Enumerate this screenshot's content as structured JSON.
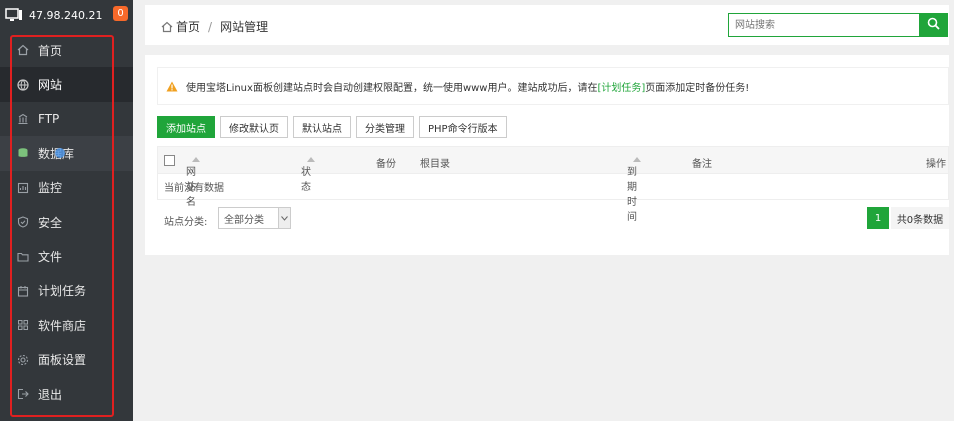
{
  "server": {
    "ip": "47.98.240.21",
    "badge": "0"
  },
  "nav": [
    {
      "label": "首页",
      "icon": "home-icon"
    },
    {
      "label": "网站",
      "icon": "globe-icon"
    },
    {
      "label": "FTP",
      "icon": "ftp-icon"
    },
    {
      "label": "数据库",
      "icon": "database-icon"
    },
    {
      "label": "监控",
      "icon": "monitor-icon"
    },
    {
      "label": "安全",
      "icon": "shield-icon"
    },
    {
      "label": "文件",
      "icon": "folder-icon"
    },
    {
      "label": "计划任务",
      "icon": "calendar-icon"
    },
    {
      "label": "软件商店",
      "icon": "grid-icon"
    },
    {
      "label": "面板设置",
      "icon": "gear-icon"
    },
    {
      "label": "退出",
      "icon": "logout-icon"
    }
  ],
  "breadcrumb": {
    "home": "首页",
    "sep": "/",
    "current": "网站管理"
  },
  "search": {
    "placeholder": "网站搜索"
  },
  "alert": {
    "prefix": "使用宝塔Linux面板创建站点时会自动创建权限配置，统一使用www用户。建站成功后，请在",
    "link": "[计划任务]",
    "suffix": "页面添加定时备份任务!"
  },
  "toolbar": {
    "add_site": "添加站点",
    "edit_default": "修改默认页",
    "default_site": "默认站点",
    "category": "分类管理",
    "php_cli": "PHP命令行版本"
  },
  "table": {
    "headers": {
      "name": "网站名",
      "status": "状态",
      "backup": "备份",
      "root": "根目录",
      "expire": "到期时间",
      "note": "备注",
      "action": "操作"
    },
    "empty": "当前没有数据"
  },
  "footer": {
    "category_label": "站点分类:",
    "category_value": "全部分类",
    "page": "1",
    "total": "共0条数据"
  },
  "colors": {
    "accent": "#20a53a",
    "sidebar": "#33373b",
    "badge": "#f7692a",
    "highlight": "#e02020"
  }
}
